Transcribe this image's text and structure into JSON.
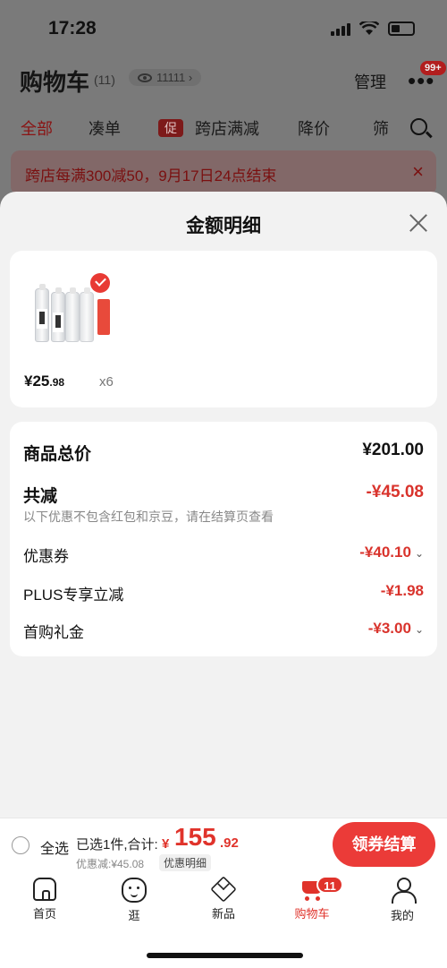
{
  "status_bar": {
    "time": "17:28"
  },
  "header": {
    "title": "购物车",
    "count": "(11)",
    "eye_count": "11111 ›",
    "manage_label": "管理",
    "more_label": "•••",
    "badge": "99+"
  },
  "tabs": [
    {
      "label": "全部"
    },
    {
      "label": "凑单"
    },
    {
      "label": "跨店满减",
      "promo_icon": "促"
    },
    {
      "label": "降价"
    },
    {
      "label": "筛"
    }
  ],
  "notice": {
    "text": "跨店每满300减50，9月17日24点结束",
    "close": "×"
  },
  "sheet": {
    "title": "金额明细",
    "product": {
      "price_int": "¥25",
      "price_dec": ".98",
      "qty": "x6"
    },
    "details": {
      "total_label": "商品总价",
      "total_value": "¥201.00",
      "reduce_label": "共减",
      "reduce_value": "-¥45.08",
      "reduce_note": "以下优惠不包含红包和京豆，请在结算页查看",
      "coupon_label": "优惠券",
      "coupon_value": "-¥40.10",
      "plus_label": "PLUS专享立减",
      "plus_value": "-¥1.98",
      "first_label": "首购礼金",
      "first_value": "-¥3.00",
      "chevron": "⌄"
    }
  },
  "checkout": {
    "select_all": "全选",
    "selected": "已选1件,合计:",
    "yen": "¥",
    "total_int": "155",
    "total_dec": ".92",
    "discount": "优惠减:¥45.08",
    "detail_chip": "优惠明细",
    "button": "领券结算"
  },
  "tabbar": {
    "items": [
      {
        "label": "首页",
        "icon": "home-icon"
      },
      {
        "label": "逛",
        "icon": "browse-icon"
      },
      {
        "label": "新品",
        "icon": "new-products-icon"
      },
      {
        "label": "购物车",
        "icon": "cart-icon"
      },
      {
        "label": "我的",
        "icon": "user-icon"
      }
    ],
    "cart_badge": "11"
  },
  "colors": {
    "accent": "#e0332b",
    "button": "#eb3b38"
  }
}
